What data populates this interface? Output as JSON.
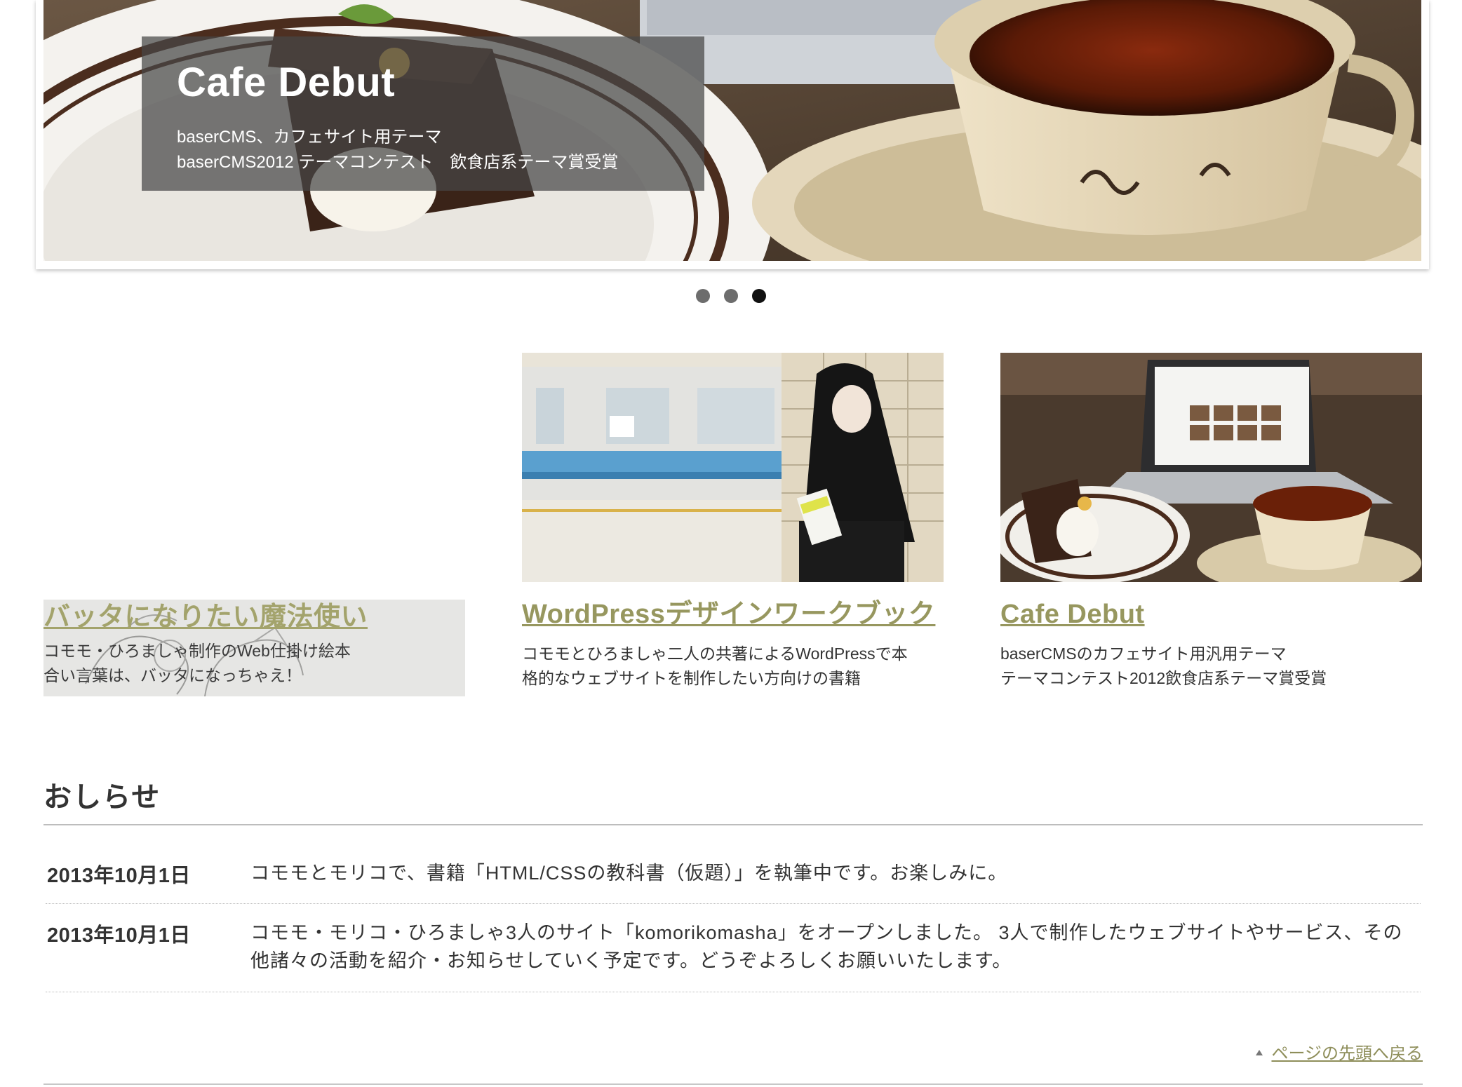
{
  "hero": {
    "caption_title": "Cafe Debut",
    "caption_line1": "baserCMS、カフェサイト用テーマ",
    "caption_line2": "baserCMS2012 テーマコンテスト　飲食店系テーマ賞受賞",
    "slide_count": 3,
    "active_slide": 3
  },
  "cards": [
    {
      "title": "バッタになりたい魔法使い",
      "desc_line1": "コモモ・ひろましゃ制作のWeb仕掛け絵本",
      "desc_line2": "合い言葉は、バッタになっちゃえ！"
    },
    {
      "title": "WordPressデザインワークブック",
      "desc_line1": "コモモとひろましゃ二人の共著によるWordPressで本",
      "desc_line2": "格的なウェブサイトを制作したい方向けの書籍"
    },
    {
      "title": "Cafe Debut",
      "desc_line1": "baserCMSのカフェサイト用汎用テーマ",
      "desc_line2": "テーマコンテスト2012飲食店系テーマ賞受賞"
    }
  ],
  "news": {
    "heading": "おしらせ",
    "items": [
      {
        "date": "2013年10月1日",
        "text": "コモモとモリコで、書籍「HTML/CSSの教科書（仮題）」を執筆中です。お楽しみに。"
      },
      {
        "date": "2013年10月1日",
        "text": "コモモ・モリコ・ひろましゃ3人のサイト「komorikomasha」をオープンしました。 3人で制作したウェブサイトやサービス、その他諸々の活動を紹介・お知らせしていく予定です。どうぞよろしくお願いいたします。"
      }
    ]
  },
  "back_to_top": "ページの先頭へ戻る",
  "colors": {
    "link": "#97975f",
    "text": "#333333",
    "caption_bg": "rgba(70,70,70,0.72)",
    "dot": "#6d6d6d",
    "dot_active": "#111111"
  }
}
